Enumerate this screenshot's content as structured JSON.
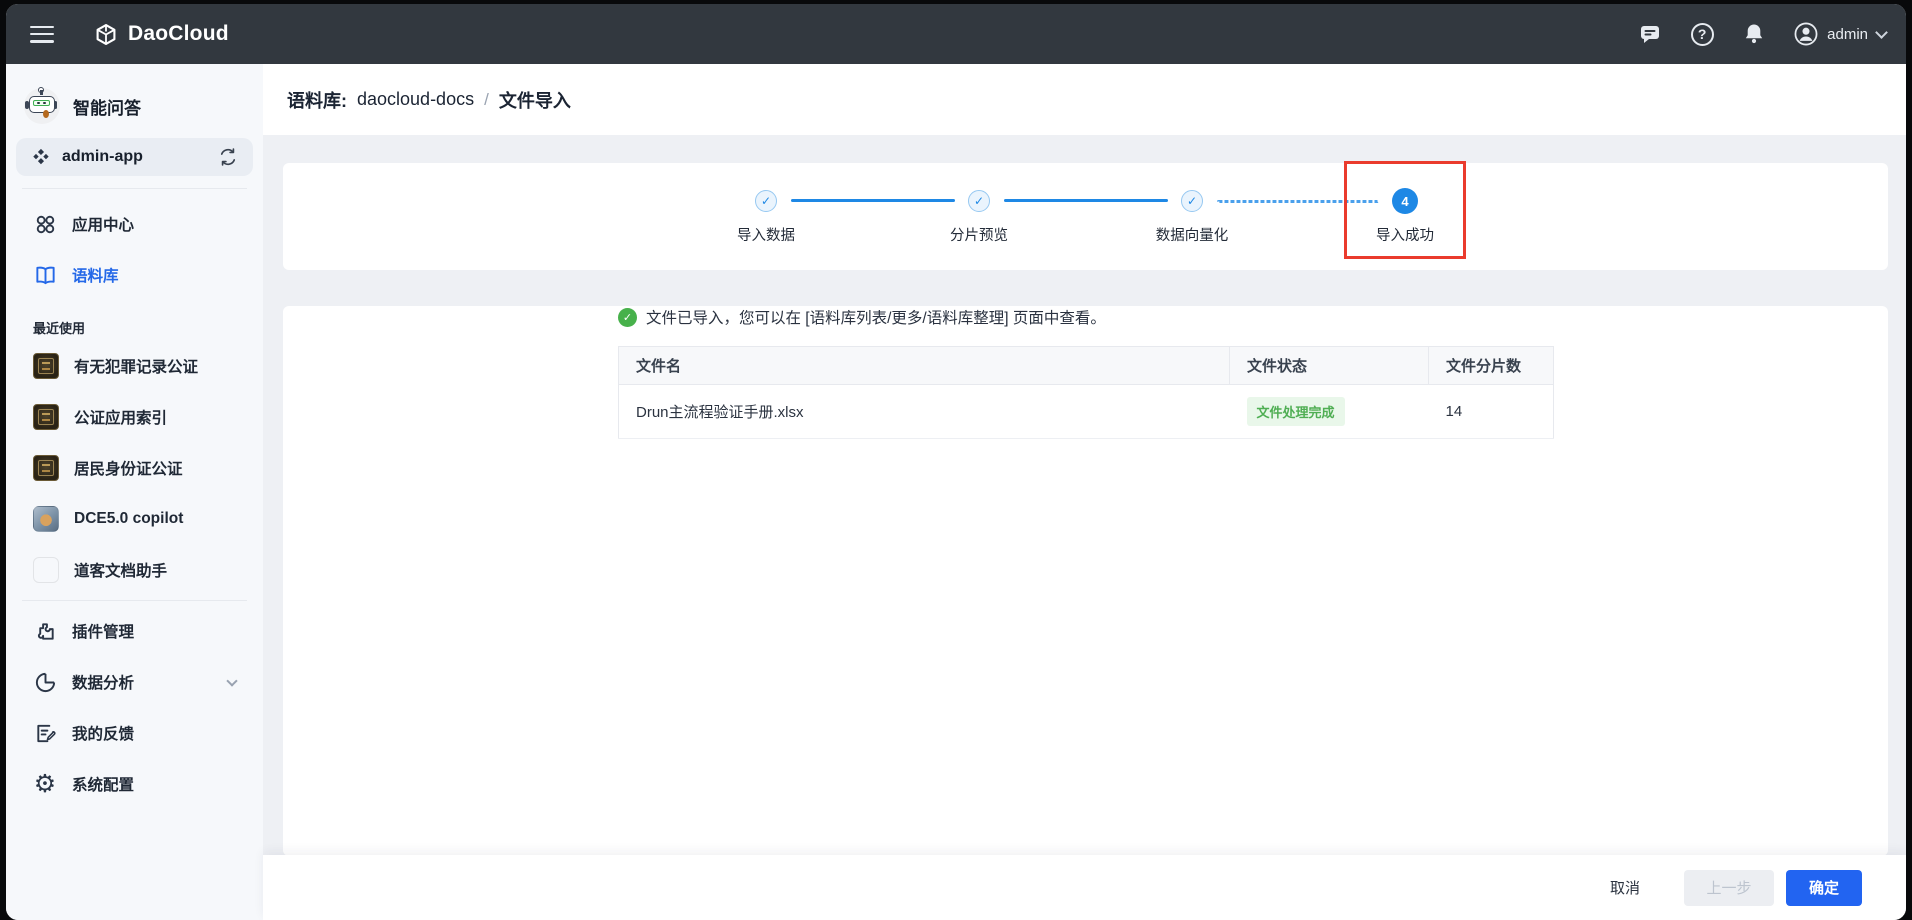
{
  "topbar": {
    "brand": "DaoCloud",
    "user": "admin"
  },
  "sidebar": {
    "app_title": "智能问答",
    "app_switcher": {
      "name": "admin-app"
    },
    "nav": [
      {
        "label": "应用中心"
      },
      {
        "label": "语料库",
        "active": true
      }
    ],
    "recent_title": "最近使用",
    "recent": [
      {
        "label": "有无犯罪记录公证"
      },
      {
        "label": "公证应用索引"
      },
      {
        "label": "居民身份证公证"
      },
      {
        "label": "DCE5.0 copilot"
      },
      {
        "label": "道客文档助手"
      }
    ],
    "bottom": [
      {
        "label": "插件管理"
      },
      {
        "label": "数据分析"
      },
      {
        "label": "我的反馈"
      },
      {
        "label": "系统配置"
      }
    ]
  },
  "breadcrumb": {
    "prefix": "语料库:",
    "library": "daocloud-docs",
    "separator": "/",
    "current": "文件导入"
  },
  "stepper": {
    "steps": [
      {
        "label": "导入数据",
        "state": "done"
      },
      {
        "label": "分片预览",
        "state": "done"
      },
      {
        "label": "数据向量化",
        "state": "done"
      },
      {
        "label": "导入成功",
        "state": "current",
        "number": "4"
      }
    ]
  },
  "result": {
    "message": "文件已导入，您可以在 [语料库列表/更多/语料库整理] 页面中查看。",
    "table": {
      "headers": [
        "文件名",
        "文件状态",
        "文件分片数"
      ],
      "rows": [
        {
          "file_name": "Drun主流程验证手册.xlsx",
          "status": "文件处理完成",
          "chunks": "14"
        }
      ]
    }
  },
  "footer": {
    "cancel": "取消",
    "previous": "上一步",
    "confirm": "确定"
  },
  "colors": {
    "topbar_bg": "#32383f",
    "sidebar_bg": "#f6f8fb",
    "content_bg": "#eef0f4",
    "stepper_blue": "#1e88e5",
    "primary_blue": "#2264f1",
    "active_link_blue": "#2468e8",
    "success_green": "#47b14b",
    "badge_bg": "#e9f7ea",
    "badge_text": "#4fae53",
    "annotation_red": "#ea3b2d"
  }
}
